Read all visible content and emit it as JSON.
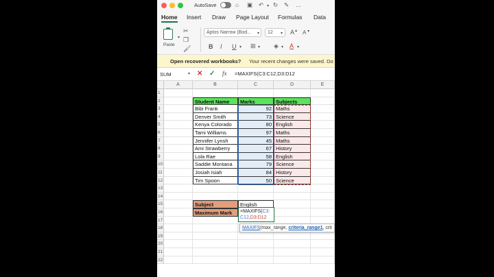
{
  "titlebar": {
    "autosave_label": "AutoSave",
    "icons": [
      "home-icon",
      "save-icon",
      "undo-icon",
      "redo-icon",
      "pen-icon"
    ]
  },
  "tabs": [
    "Home",
    "Insert",
    "Draw",
    "Page Layout",
    "Formulas",
    "Data"
  ],
  "ribbon": {
    "paste_label": "Paste",
    "font_name": "Aptos Narrow (Bod...",
    "font_size": "12",
    "bold": "B",
    "italic": "I",
    "underline": "U",
    "grow_font": "A",
    "shrink_font": "A",
    "font_color_glyph": "A"
  },
  "notification": {
    "title": "Open recovered workbooks?",
    "message": "Your recent changes were saved. Do yo"
  },
  "formula_bar": {
    "name_box": "SUM",
    "fx": "fx",
    "formula": "=MAXIFS(C3:C12,D3:D12"
  },
  "columns": [
    "A",
    "B",
    "C",
    "D",
    "E"
  ],
  "rows": [
    "1",
    "2",
    "3",
    "4",
    "5",
    "6",
    "7",
    "8",
    "9",
    "10",
    "11",
    "12",
    "13",
    "14",
    "15",
    "16",
    "17",
    "18",
    "19",
    "20",
    "21",
    "22"
  ],
  "table": {
    "headers": [
      "Student Name",
      "Marks",
      "Subjects"
    ],
    "records": [
      {
        "name": "Bibi Frank",
        "mark": "92",
        "subject": "Maths"
      },
      {
        "name": "Denver  Smith",
        "mark": "73",
        "subject": "Science"
      },
      {
        "name": "Kenya Colorado",
        "mark": "80",
        "subject": "English"
      },
      {
        "name": "Tami  Williams",
        "mark": "97",
        "subject": "Maths"
      },
      {
        "name": "Jennifer Lynsh",
        "mark": "45",
        "subject": "Maths"
      },
      {
        "name": "Ami Strawberry",
        "mark": "67",
        "subject": "History"
      },
      {
        "name": "Lola Rae",
        "mark": "58",
        "subject": "English"
      },
      {
        "name": "Saddie Montana",
        "mark": "79",
        "subject": "Science"
      },
      {
        "name": "Josiah Isiah",
        "mark": "84",
        "subject": "History"
      },
      {
        "name": "Tim Spoon",
        "mark": "50",
        "subject": "Science"
      }
    ]
  },
  "summary": {
    "subject_label": "Subject",
    "subject_value": "English",
    "max_label": "Maximum Mark",
    "edit_prefix": "=MAXIFS(",
    "edit_ref1": "C3:",
    "edit_ref1b": "C12",
    "edit_comma": ",",
    "edit_ref2": "D3:D12"
  },
  "tooltip": {
    "fn": "MAXIFS",
    "open": "(",
    "arg1": "max_range",
    "sep1": ", ",
    "arg2": "criteria_range1",
    "sep2": ", crit"
  },
  "colors": {
    "header_green": "#5be35b",
    "label_orange": "#e29d7c",
    "range_blue": "#3c79c7",
    "range_red": "#c0392b",
    "excel_green": "#1a7343"
  }
}
